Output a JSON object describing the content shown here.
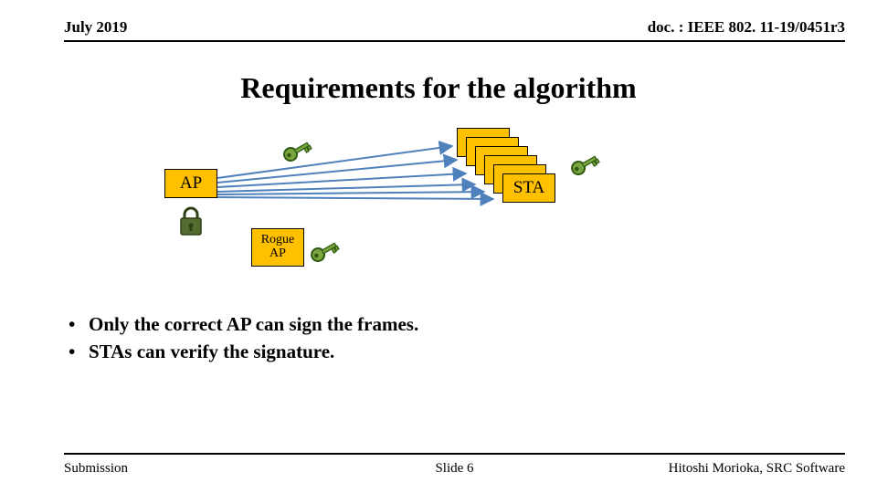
{
  "header": {
    "date": "July 2019",
    "doc": "doc. : IEEE 802. 11-19/0451r3"
  },
  "title": "Requirements for the algorithm",
  "diagram": {
    "ap_label": "AP",
    "sta_label": "STA",
    "rogue_label": "Rogue\nAP"
  },
  "bullets": [
    "Only the correct AP can sign the frames.",
    "STAs can verify the signature."
  ],
  "footer": {
    "left": "Submission",
    "mid": "Slide 6",
    "right": "Hitoshi Morioka, SRC Software"
  }
}
